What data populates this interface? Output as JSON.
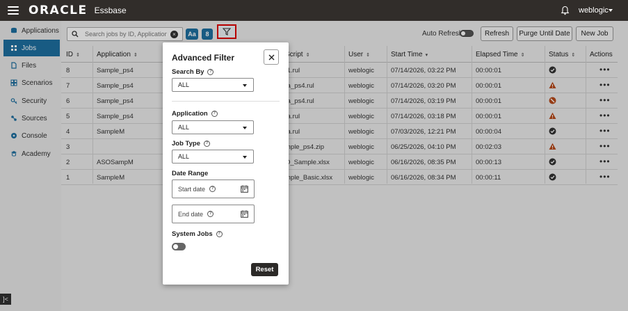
{
  "header": {
    "logo": "ORACLE",
    "product": "Essbase",
    "username": "weblogic"
  },
  "sidebar": {
    "items": [
      {
        "label": "Applications",
        "icon": "applications-icon"
      },
      {
        "label": "Jobs",
        "icon": "jobs-icon",
        "active": true
      },
      {
        "label": "Files",
        "icon": "files-icon"
      },
      {
        "label": "Scenarios",
        "icon": "scenarios-icon"
      },
      {
        "label": "Security",
        "icon": "security-icon"
      },
      {
        "label": "Sources",
        "icon": "sources-icon"
      },
      {
        "label": "Console",
        "icon": "console-icon"
      },
      {
        "label": "Academy",
        "icon": "academy-icon"
      }
    ]
  },
  "toolbar": {
    "search_placeholder": "Search jobs by ID, Application,",
    "case_label": "Aa",
    "count_badge": "8",
    "auto_refresh_label": "Auto Refresh",
    "refresh_label": "Refresh",
    "purge_label": "Purge Until Date",
    "new_job_label": "New Job"
  },
  "table": {
    "columns": [
      "ID",
      "Application",
      "Script",
      "User",
      "Start Time",
      "Elapsed Time",
      "Status",
      "Actions"
    ],
    "rows": [
      {
        "id": "8",
        "application": "Sample_ps4",
        "script": "t1.rul",
        "user": "weblogic",
        "start": "07/14/2026, 03:22 PM",
        "elapsed": "00:00:01",
        "status": "success"
      },
      {
        "id": "7",
        "application": "Sample_ps4",
        "script": "ta_ps4.rul",
        "user": "weblogic",
        "start": "07/14/2026, 03:20 PM",
        "elapsed": "00:00:01",
        "status": "warning"
      },
      {
        "id": "6",
        "application": "Sample_ps4",
        "script": "ta_ps4.rul",
        "user": "weblogic",
        "start": "07/14/2026, 03:19 PM",
        "elapsed": "00:00:01",
        "status": "error"
      },
      {
        "id": "5",
        "application": "Sample_ps4",
        "script": "ta.rul",
        "user": "weblogic",
        "start": "07/14/2026, 03:18 PM",
        "elapsed": "00:00:01",
        "status": "warning"
      },
      {
        "id": "4",
        "application": "SampleM",
        "script": "ta.rul",
        "user": "weblogic",
        "start": "07/03/2026, 12:21 PM",
        "elapsed": "00:00:04",
        "status": "success"
      },
      {
        "id": "3",
        "application": "",
        "script": "mple_ps4.zip",
        "user": "weblogic",
        "start": "06/25/2026, 04:10 PM",
        "elapsed": "00:02:03",
        "status": "warning"
      },
      {
        "id": "2",
        "application": "ASOSampM",
        "script": "O_Sample.xlsx",
        "user": "weblogic",
        "start": "06/16/2026, 08:35 PM",
        "elapsed": "00:00:13",
        "status": "success"
      },
      {
        "id": "1",
        "application": "SampleM",
        "script": "mple_Basic.xlsx",
        "user": "weblogic",
        "start": "06/16/2026, 08:34 PM",
        "elapsed": "00:00:11",
        "status": "success"
      }
    ]
  },
  "dialog": {
    "title": "Advanced Filter",
    "search_by_label": "Search By",
    "search_by_value": "ALL",
    "application_label": "Application",
    "application_value": "ALL",
    "job_type_label": "Job Type",
    "job_type_value": "ALL",
    "date_range_label": "Date Range",
    "start_date_placeholder": "Start date",
    "end_date_placeholder": "End date",
    "system_jobs_label": "System Jobs",
    "reset_label": "Reset"
  },
  "colors": {
    "header_bg": "#312d2a",
    "accent": "#1e6fa0",
    "highlight_border": "#e00000",
    "warning": "#c0392b"
  }
}
